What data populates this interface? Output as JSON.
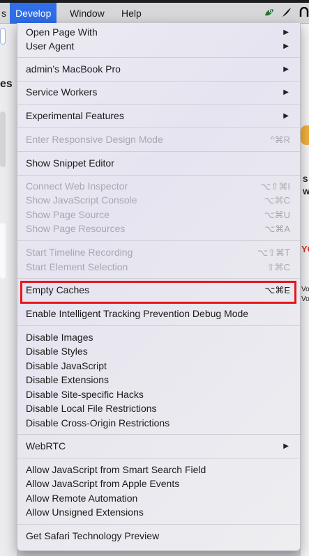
{
  "menubar": {
    "partial_left": "s",
    "develop": "Develop",
    "window": "Window",
    "help": "Help"
  },
  "background": {
    "frag_es": "es",
    "frag_s": "S",
    "frag_w": "W",
    "frag_vo": "Vo",
    "frag_vo2": "Vo",
    "frag_yc": "YC"
  },
  "menu": {
    "open_page_with": "Open Page With",
    "user_agent": "User Agent",
    "macbook": "admin’s MacBook Pro",
    "service_workers": "Service Workers",
    "experimental_features": "Experimental Features",
    "responsive_design": "Enter Responsive Design Mode",
    "responsive_design_sc": "^⌘R",
    "snippet_editor": "Show Snippet Editor",
    "connect_inspector": "Connect Web Inspector",
    "connect_inspector_sc": "⌥⇧⌘I",
    "js_console": "Show JavaScript Console",
    "js_console_sc": "⌥⌘C",
    "page_source": "Show Page Source",
    "page_source_sc": "⌥⌘U",
    "page_resources": "Show Page Resources",
    "page_resources_sc": "⌥⌘A",
    "timeline": "Start Timeline Recording",
    "timeline_sc": "⌥⇧⌘T",
    "element_selection": "Start Element Selection",
    "element_selection_sc": "⇧⌘C",
    "empty_caches": "Empty Caches",
    "empty_caches_sc": "⌥⌘E",
    "itp_debug": "Enable Intelligent Tracking Prevention Debug Mode",
    "disable_images": "Disable Images",
    "disable_styles": "Disable Styles",
    "disable_js": "Disable JavaScript",
    "disable_extensions": "Disable Extensions",
    "disable_site_hacks": "Disable Site-specific Hacks",
    "disable_local_file": "Disable Local File Restrictions",
    "disable_cross_origin": "Disable Cross-Origin Restrictions",
    "webrtc": "WebRTC",
    "allow_js_smart_search": "Allow JavaScript from Smart Search Field",
    "allow_js_apple_events": "Allow JavaScript from Apple Events",
    "allow_remote_automation": "Allow Remote Automation",
    "allow_unsigned_ext": "Allow Unsigned Extensions",
    "get_tech_preview": "Get Safari Technology Preview"
  },
  "colors": {
    "menubar_active": "#2f6ee8",
    "highlight_box": "#e8151b",
    "disabled_text": "#a8a7ae"
  }
}
